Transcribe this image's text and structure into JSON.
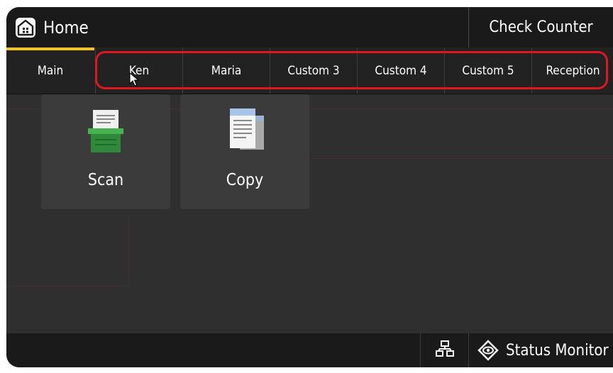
{
  "header": {
    "title": "Home",
    "counter_label": "Check Counter"
  },
  "tabs": [
    {
      "label": "Main",
      "active": true
    },
    {
      "label": "Ken"
    },
    {
      "label": "Maria"
    },
    {
      "label": "Custom 3"
    },
    {
      "label": "Custom 4"
    },
    {
      "label": "Custom 5"
    },
    {
      "label": "Reception"
    }
  ],
  "tiles": [
    {
      "label": "Scan",
      "icon": "scanner-icon"
    },
    {
      "label": "Copy",
      "icon": "copy-icon"
    }
  ],
  "footer": {
    "network_icon": "network-icon",
    "status_label": "Status Monitor",
    "status_icon": "status-monitor-icon"
  },
  "colors": {
    "active_tab_indicator": "#f5c518",
    "highlight": "#e3161f",
    "scanner_green": "#2e8a3a"
  }
}
